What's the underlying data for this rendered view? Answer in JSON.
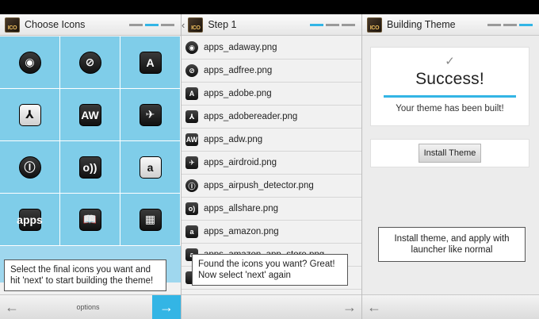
{
  "panels": [
    {
      "title": "Choose Icons",
      "step_index": 0,
      "grid_icons": [
        "target-icon",
        "no-entry-icon",
        "a-logo-icon",
        "pdf-icon",
        "adw-icon",
        "airdroid-icon",
        "airpush-icon",
        "allshare-icon",
        "amazon-icon",
        "amazon-apps-icon",
        "reader-icon",
        "market-icon"
      ],
      "grid_glyphs": [
        "◉",
        "⊘",
        "A",
        "⅄",
        "AW",
        "✈",
        "Ⓘ",
        "o))",
        "a",
        "apps",
        "📖",
        "▦"
      ],
      "hint": "Select the final icons you want and hit 'next' to start building the theme!",
      "bottom_label": "options"
    },
    {
      "title": "Step 1",
      "step_index": 1,
      "files": [
        {
          "name": "apps_adaway.png",
          "glyph": "◉"
        },
        {
          "name": "apps_adfree.png",
          "glyph": "⊘"
        },
        {
          "name": "apps_adobe.png",
          "glyph": "A"
        },
        {
          "name": "apps_adobereader.png",
          "glyph": "⅄"
        },
        {
          "name": "apps_adw.png",
          "glyph": "AW"
        },
        {
          "name": "apps_airdroid.png",
          "glyph": "✈"
        },
        {
          "name": "apps_airpush_detector.png",
          "glyph": "Ⓘ"
        },
        {
          "name": "apps_allshare.png",
          "glyph": "o)"
        },
        {
          "name": "apps_amazon.png",
          "glyph": "a"
        },
        {
          "name": "apps_amazon_app_store.png",
          "glyph": "a"
        },
        {
          "name": "",
          "glyph": ""
        }
      ],
      "hint": "Found the icons you want? Great! Now select 'next' again"
    },
    {
      "title": "Building Theme",
      "step_index": 2,
      "success_title": "Success!",
      "success_message": "Your theme has been built!",
      "install_button": "Install Theme",
      "hint": "Install theme, and apply with launcher like normal"
    }
  ],
  "app_icon_text": "ICO",
  "colors": {
    "accent": "#33b5e5",
    "grid_bg": "#7fcde9"
  }
}
